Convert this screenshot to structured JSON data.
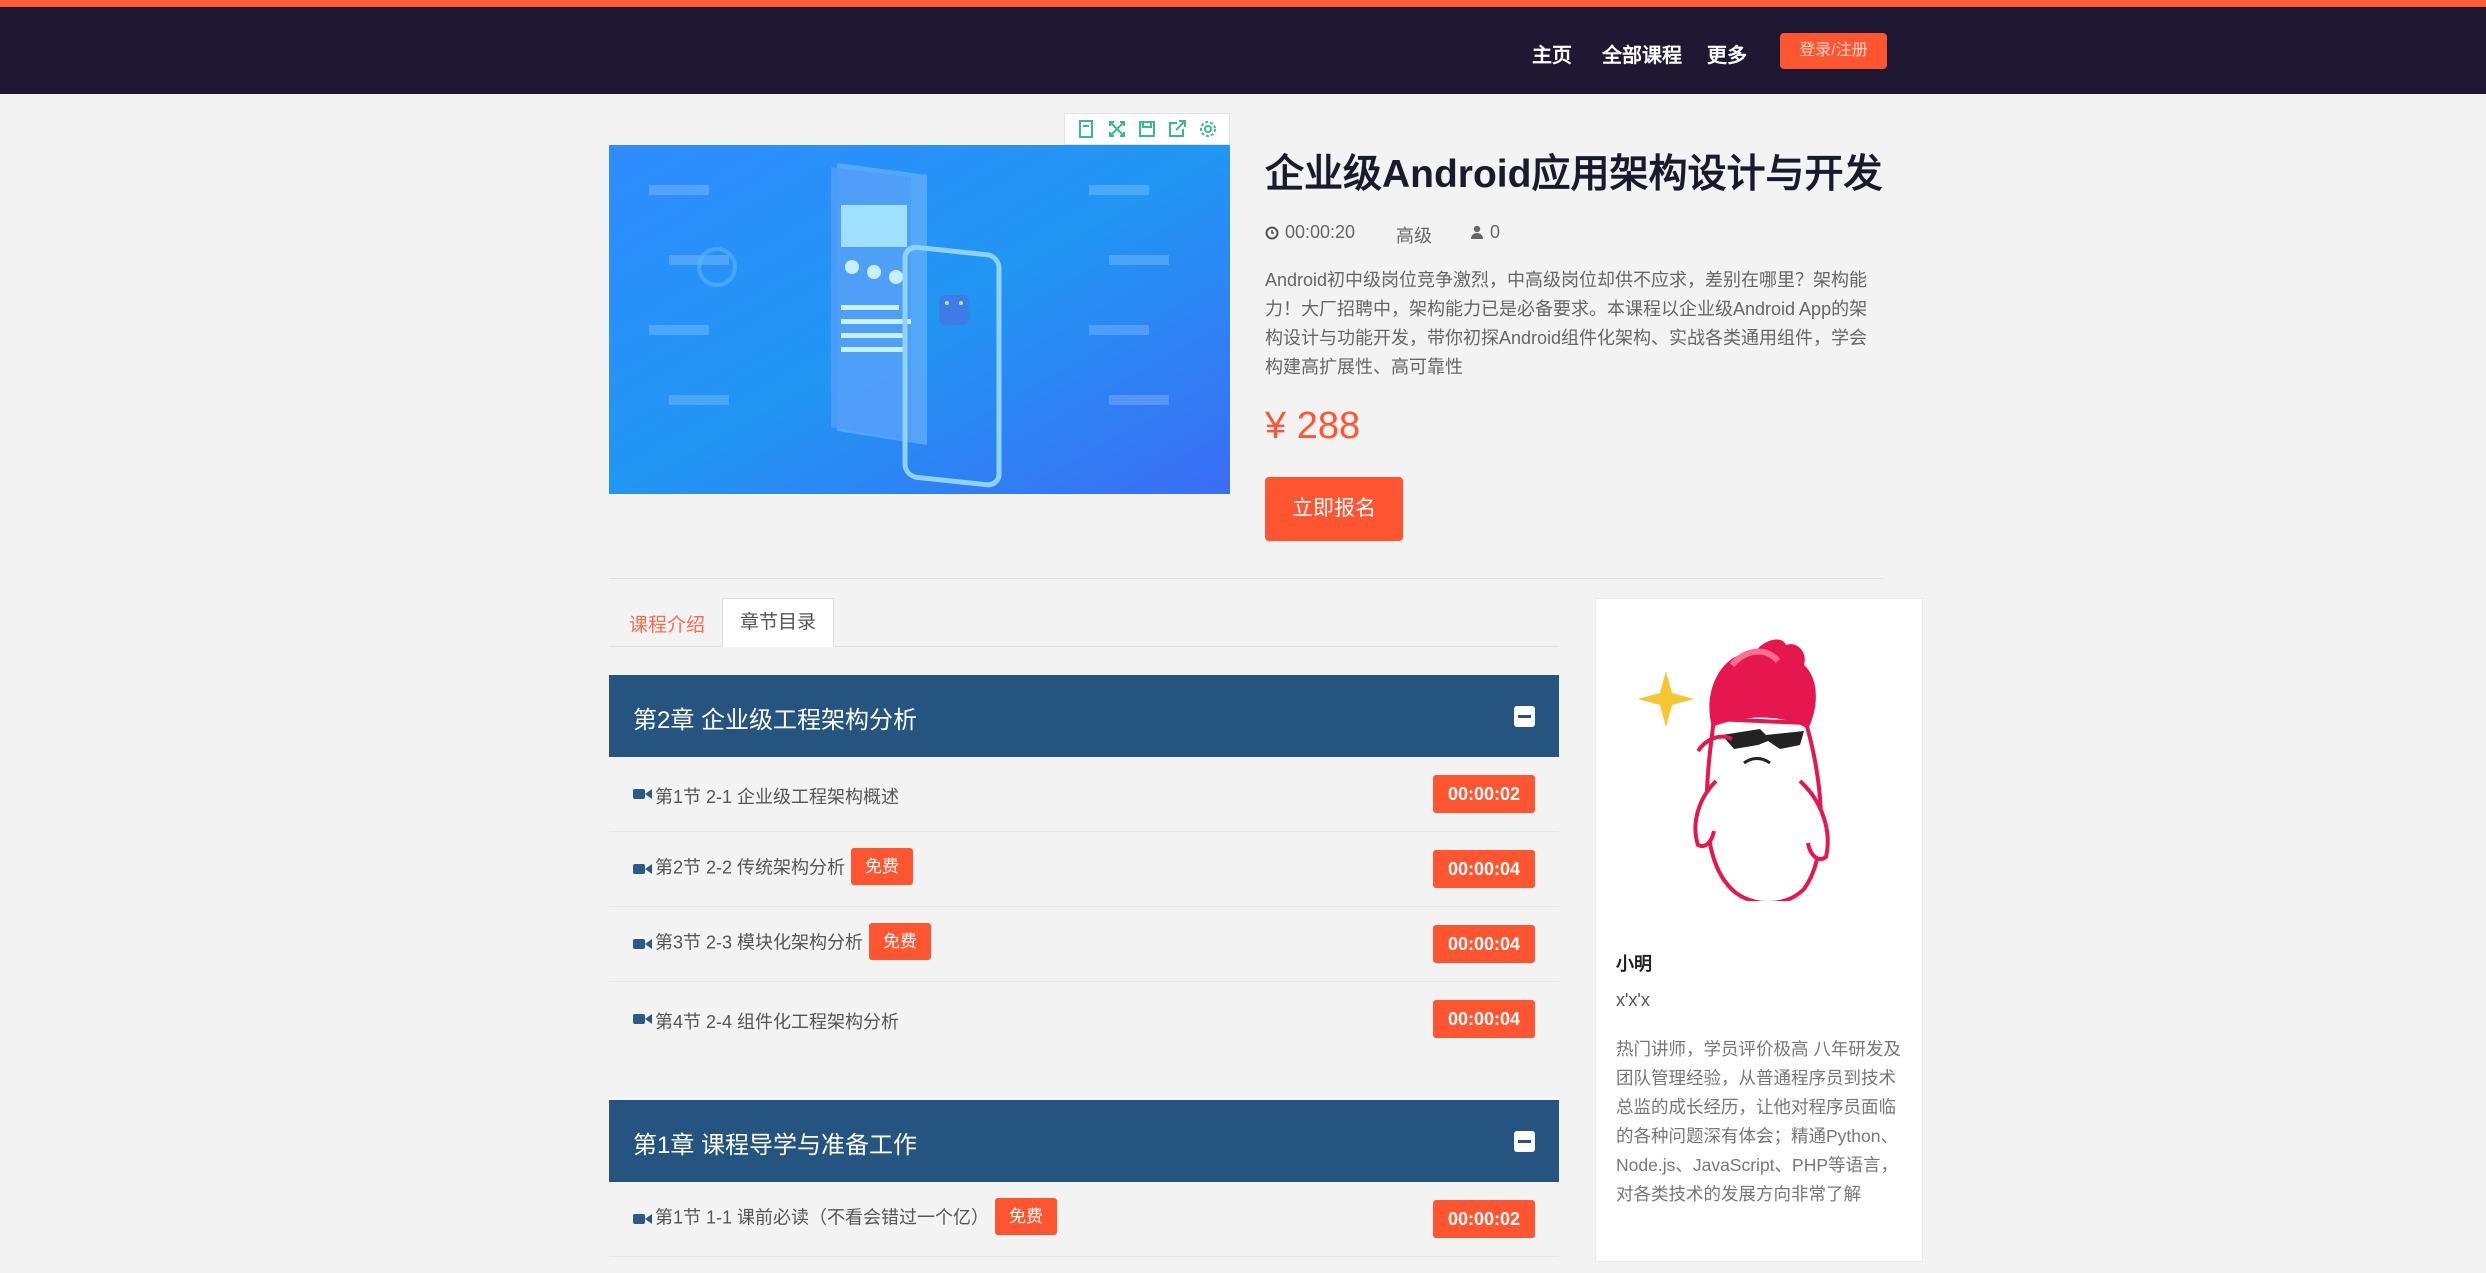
{
  "nav": {
    "items": [
      "主页",
      "全部课程",
      "更多"
    ],
    "login_label": "登录/注册"
  },
  "media_toolbar": {
    "icons": [
      "bookmark-icon",
      "fullscreen-icon",
      "save-icon",
      "share-icon",
      "settings-icon"
    ]
  },
  "course": {
    "title": "企业级Android应用架构设计与开发",
    "duration": "00:00:20",
    "level": "高级",
    "students": "0",
    "description": "Android初中级岗位竞争激烈，中高级岗位却供不应求，差别在哪里？架构能力！大厂招聘中，架构能力已是必备要求。本课程以企业级Android App的架构设计与功能开发，带你初探Android组件化架构、实战各类通用组件，学会构建高扩展性、高可靠性",
    "price": "¥ 288",
    "enroll_label": "立即报名"
  },
  "tabs": {
    "intro": "课程介绍",
    "toc": "章节目录"
  },
  "chapters": [
    {
      "title": "第2章 企业级工程架构分析",
      "lessons": [
        {
          "title": "第1节 2-1 企业级工程架构概述",
          "free": "",
          "duration": "00:00:02"
        },
        {
          "title": "第2节 2-2 传统架构分析",
          "free": "免费",
          "duration": "00:00:04"
        },
        {
          "title": "第3节 2-3 模块化架构分析",
          "free": "免费",
          "duration": "00:00:04"
        },
        {
          "title": "第4节 2-4 组件化工程架构分析",
          "free": "",
          "duration": "00:00:04"
        }
      ]
    },
    {
      "title": "第1章 课程导学与准备工作",
      "lessons": [
        {
          "title": "第1节 1-1 课前必读（不看会错过一个亿）",
          "free": "免费",
          "duration": "00:00:02"
        }
      ]
    }
  ],
  "teacher": {
    "name": "小明",
    "subtitle": "x'x'x",
    "bio": "热门讲师，学员评价极高 八年研发及团队管理经验，从普通程序员到技术总监的成长经历，让他对程序员面临的各种问题深有体会；精通Python、Node.js、JavaScript、PHP等语言，对各类技术的发展方向非常了解"
  },
  "colors": {
    "navbar": "#1f1833",
    "accent": "#ff5530",
    "chapter_bar": "#255480"
  }
}
